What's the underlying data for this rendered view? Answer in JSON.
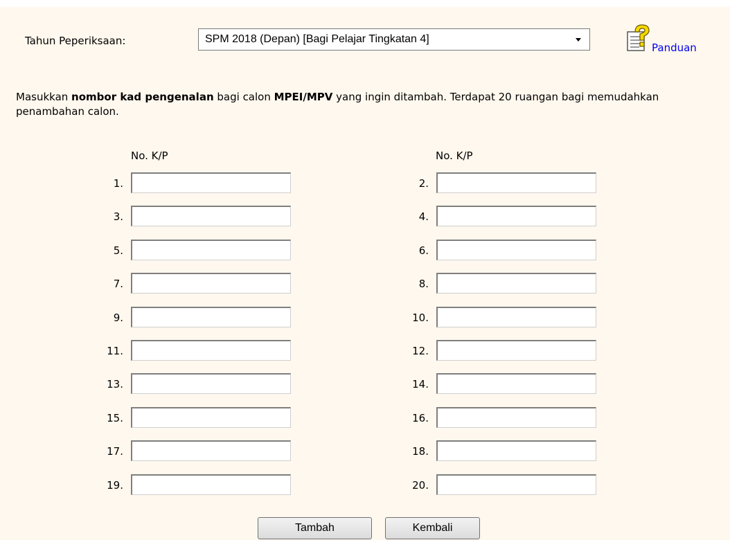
{
  "exam": {
    "label": "Tahun Peperiksaan:",
    "selected": "SPM 2018 (Depan) [Bagi Pelajar Tingkatan 4]"
  },
  "guide": {
    "label": "Panduan",
    "icon": "help-document-icon"
  },
  "instructions": {
    "part1": "Masukkan ",
    "bold1": "nombor kad pengenalan",
    "part2": " bagi calon ",
    "bold2": "MPEI/MPV",
    "part3": " yang ingin ditambah.   Terdapat 20 ruangan bagi memudahkan penambahan calon."
  },
  "form": {
    "column_header": "No. K/P",
    "rows": [
      {
        "label": "1.",
        "value": ""
      },
      {
        "label": "2.",
        "value": ""
      },
      {
        "label": "3.",
        "value": ""
      },
      {
        "label": "4.",
        "value": ""
      },
      {
        "label": "5.",
        "value": ""
      },
      {
        "label": "6.",
        "value": ""
      },
      {
        "label": "7.",
        "value": ""
      },
      {
        "label": "8.",
        "value": ""
      },
      {
        "label": "9.",
        "value": ""
      },
      {
        "label": "10.",
        "value": ""
      },
      {
        "label": "11.",
        "value": ""
      },
      {
        "label": "12.",
        "value": ""
      },
      {
        "label": "13.",
        "value": ""
      },
      {
        "label": "14.",
        "value": ""
      },
      {
        "label": "15.",
        "value": ""
      },
      {
        "label": "16.",
        "value": ""
      },
      {
        "label": "17.",
        "value": ""
      },
      {
        "label": "18.",
        "value": ""
      },
      {
        "label": "19.",
        "value": ""
      },
      {
        "label": "20.",
        "value": ""
      }
    ]
  },
  "buttons": {
    "add": "Tambah",
    "back": "Kembali"
  },
  "colors": {
    "panel_background": "#FFF8EE",
    "link": "#0000EE"
  }
}
